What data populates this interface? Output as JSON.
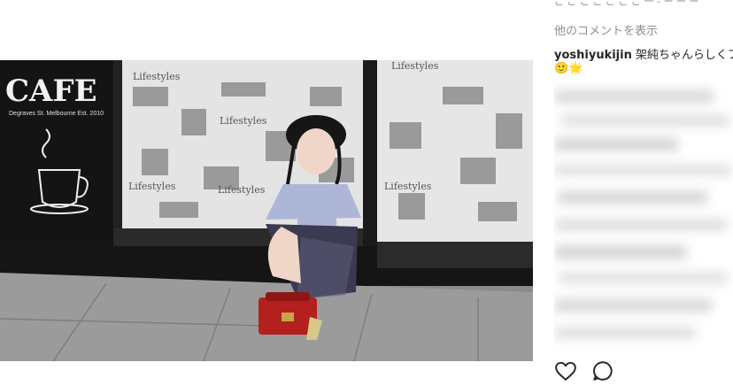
{
  "sidebar": {
    "top_partial_text": "ご ご ご ご ご ご ご 一 - ー ー ー",
    "more_comments": "他のコメントを表示",
    "comment": {
      "username": "yoshiyukijin",
      "text": "架純ちゃんらしくフ",
      "emojis": "🙂🌟"
    }
  },
  "photo": {
    "sign_title": "CAFE",
    "sign_subtitle": "Degraves St. Melbourne Est. 2010",
    "window_text": "Lifestyles"
  },
  "actions": {
    "like_icon": "heart-icon",
    "comment_icon": "comment-bubble-icon"
  },
  "colors": {
    "wall": "#1d1d1d",
    "poster": "#e6e6e6",
    "pavement": "#9b9b9b",
    "bag": "#b3201e",
    "top": "#aeb6d8",
    "skirt": "#3a3a50"
  }
}
